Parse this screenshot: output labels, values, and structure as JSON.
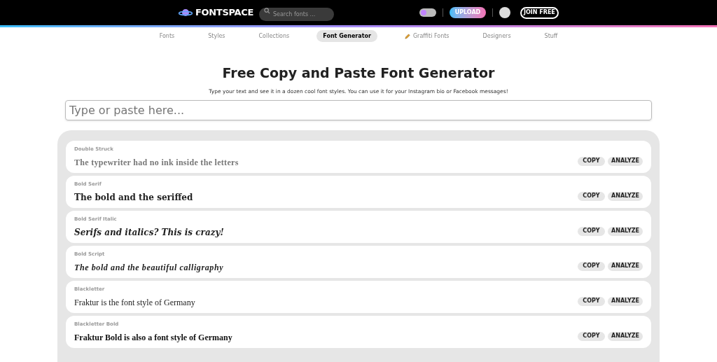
{
  "header": {
    "logo": "FONTSPACE",
    "search": {
      "placeholder": "Search fonts ..."
    },
    "dark_mode": {
      "on": false
    },
    "upload": "UPLOAD",
    "join": "JOIN FREE"
  },
  "nav": [
    {
      "label": "Fonts",
      "selected": false
    },
    {
      "label": "Styles",
      "selected": false
    },
    {
      "label": "Collections",
      "selected": false
    },
    {
      "label": "Font Generator",
      "selected": true
    },
    {
      "label": "Graffiti Fonts",
      "selected": false,
      "kind": "pencil"
    },
    {
      "label": "Designers",
      "selected": false
    },
    {
      "label": "Stuff",
      "selected": false
    }
  ],
  "title": "Free Copy and Paste Font Generator",
  "subtitle": "Type your text and see it in a dozen cool font styles. You can use it for your Instagram bio or Facebook messages!",
  "input": {
    "placeholder": "Type or paste here..."
  },
  "styles": [
    {
      "name": "Double Struck",
      "kind": "double_struck",
      "sample": "The typewriter had no ink inside the letters",
      "copy": "COPY",
      "analyze": "ANALYZE"
    },
    {
      "name": "Bold Serif",
      "kind": "bold_serif",
      "sample": "The bold and the seriffed",
      "copy": "COPY",
      "analyze": "ANALYZE"
    },
    {
      "name": "Bold Serif Italic",
      "kind": "bold_serif_italic",
      "sample": "Serifs and italics? This is crazy!",
      "copy": "COPY",
      "analyze": "ANALYZE"
    },
    {
      "name": "Bold Script",
      "kind": "bold_script",
      "sample": "The bold and the beautiful calligraphy",
      "copy": "COPY",
      "analyze": "ANALYZE"
    },
    {
      "name": "Blackletter",
      "kind": "blackletter",
      "sample": "Fraktur is the font style of Germany",
      "copy": "COPY",
      "analyze": "ANALYZE"
    },
    {
      "name": "Blackletter Bold",
      "kind": "blackletter_bold",
      "sample": "Fraktur Bold is also a font style of Germany",
      "copy": "COPY",
      "analyze": "ANALYZE"
    }
  ]
}
